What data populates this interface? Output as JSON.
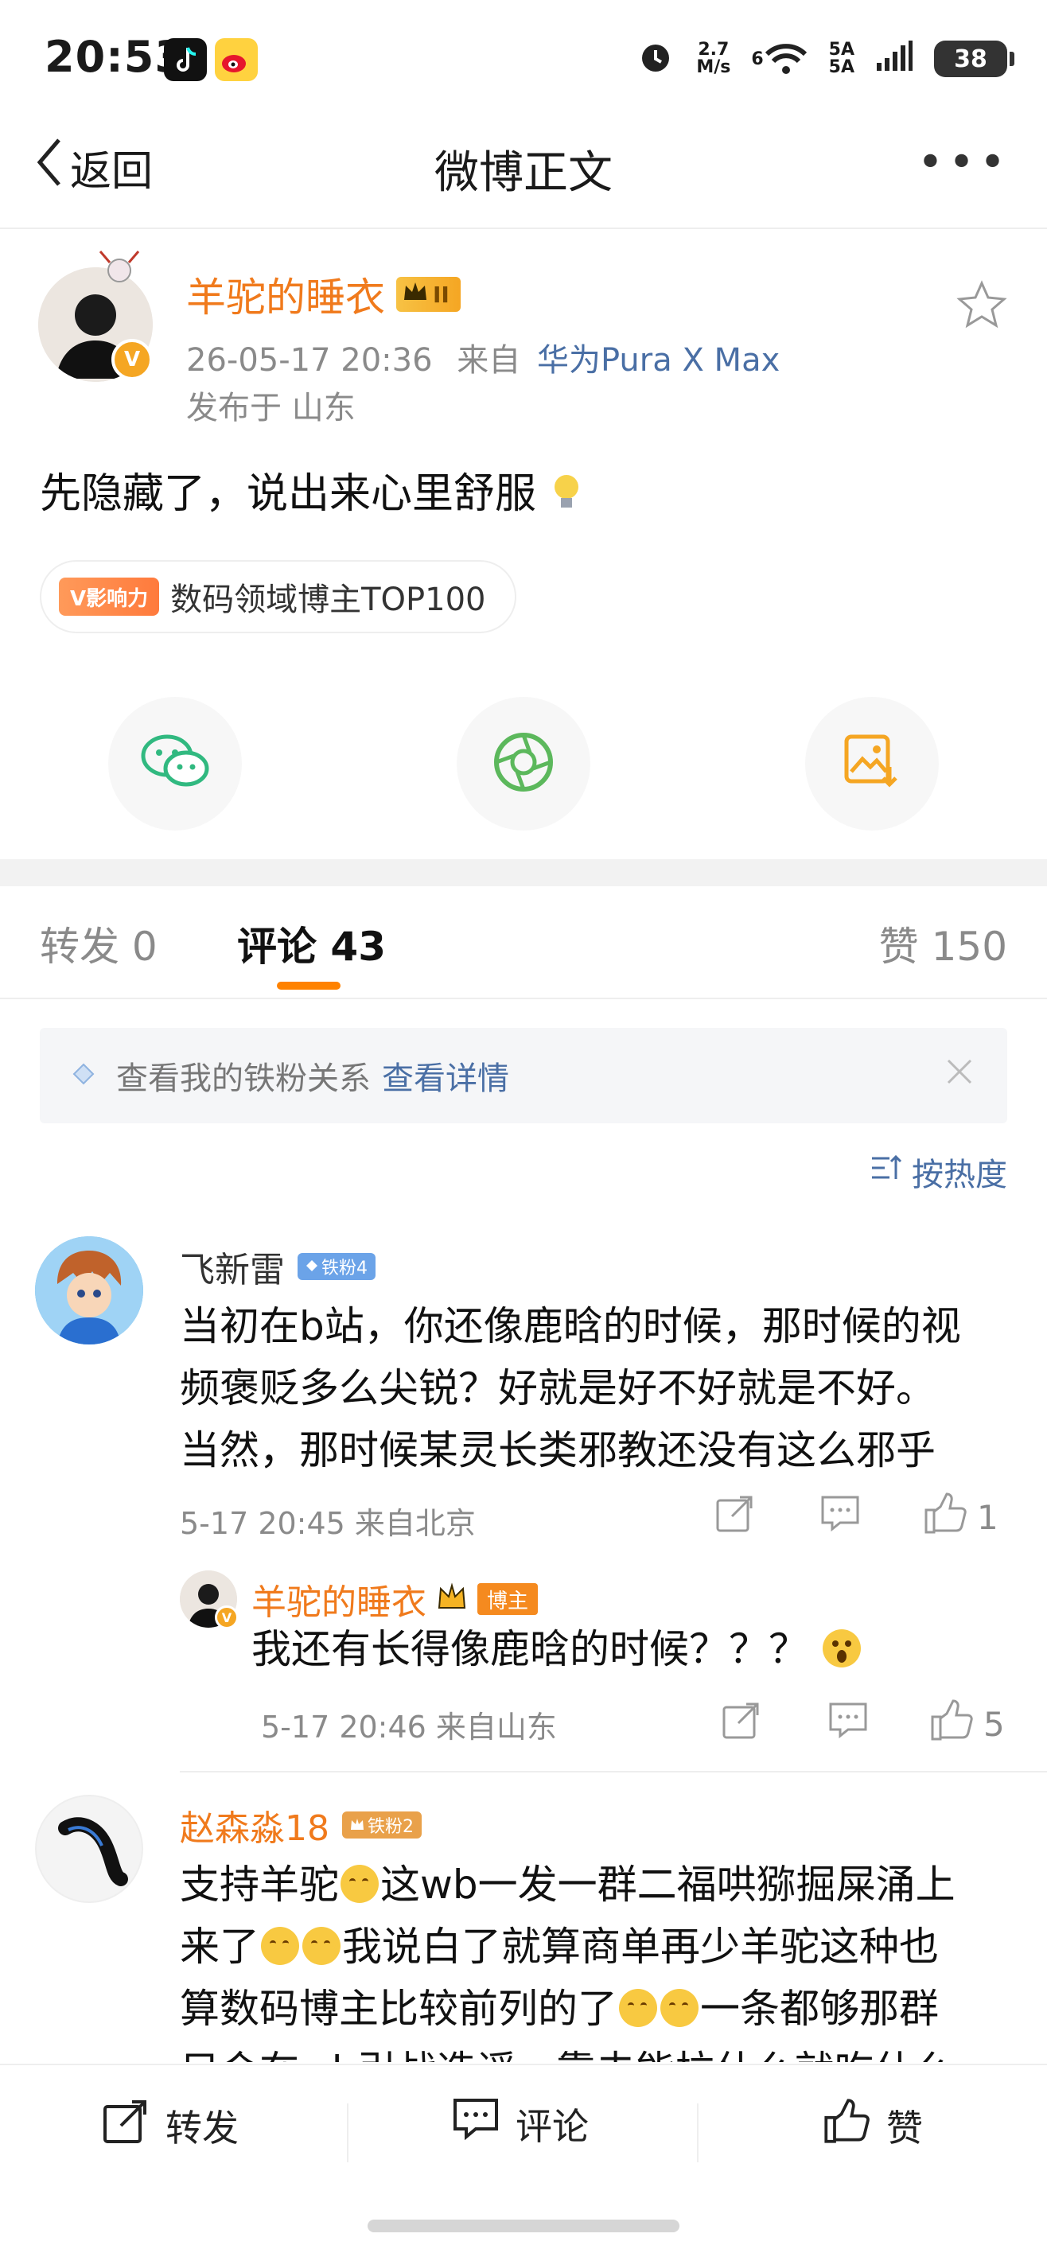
{
  "status_bar": {
    "time": "20:53",
    "net_speed_value": "2.7",
    "net_speed_unit": "M/s",
    "wifi_label": "6",
    "signal_label_1": "5A",
    "signal_label_2": "5A",
    "battery": "38"
  },
  "nav": {
    "back_label": "返回",
    "title": "微博正文",
    "more": "•••"
  },
  "post": {
    "author": "羊驼的睡衣",
    "vip_level": "II",
    "timestamp": "26-05-17 20:36",
    "source_prefix": "来自",
    "device": "华为Pura X Max",
    "location": "发布于 山东",
    "text": "先隐藏了，说出来心里舒服",
    "influence_tag": "V影响力",
    "influence_text": "数码领域博主TOP100"
  },
  "tabs": {
    "repost": "转发 0",
    "comments": "评论 43",
    "likes": "赞 150"
  },
  "fans_bar": {
    "text": "查看我的铁粉关系",
    "link": "查看详情"
  },
  "sort_label": "按热度",
  "comments": [
    {
      "name": "飞新雷",
      "badge": "铁粉4",
      "lines": [
        "当初在b站，你还像鹿晗的时候，那时候的视",
        "频褒贬多么尖锐？好就是好不好就是不好。",
        "当然，那时候某灵长类邪教还没有这么邪乎"
      ],
      "meta": "5-17 20:45 来自北京",
      "likes": "1",
      "reply": {
        "name": "羊驼的睡衣",
        "badge": "博主",
        "text": "我还有长得像鹿晗的时候？？？",
        "meta": "5-17 20:46 来自山东",
        "likes": "5"
      }
    },
    {
      "name": "赵森淼18",
      "badge": "铁粉2",
      "line1_a": "支持羊驼",
      "line1_b": "这wb一发一群二福哄猕掘屎涌上",
      "line2_a": "来了",
      "line2_b": "我说白了就算商单再少羊驼这种也",
      "line3_a": "算数码博主比较前列的了",
      "line3_b": "一条都够那群",
      "line4": "只会在wb引战造谣，靠去能拉什么就吃什么"
    }
  ],
  "bottom_bar": {
    "repost": "转发",
    "comment": "评论",
    "like": "赞"
  },
  "colors": {
    "accent_orange": "#f07a1c",
    "link_blue": "#4a6fa5",
    "tab_underline": "#ff8200"
  }
}
